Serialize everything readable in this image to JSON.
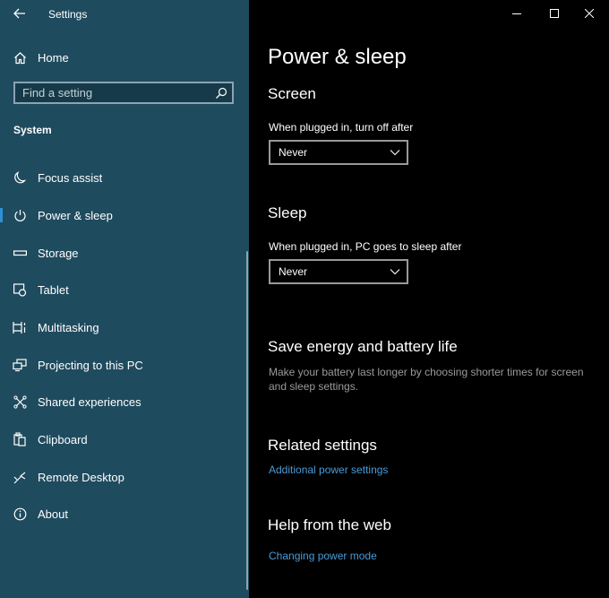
{
  "window": {
    "title": "Settings",
    "controls": {
      "minimize": "minimize",
      "maximize": "maximize",
      "close": "close"
    }
  },
  "sidebar": {
    "home_label": "Home",
    "search": {
      "placeholder": "Find a setting",
      "value": ""
    },
    "section_label": "System",
    "items": [
      {
        "label": "Focus assist",
        "icon": "moon-icon",
        "active": false
      },
      {
        "label": "Power & sleep",
        "icon": "power-icon",
        "active": true
      },
      {
        "label": "Storage",
        "icon": "storage-icon",
        "active": false
      },
      {
        "label": "Tablet",
        "icon": "tablet-icon",
        "active": false
      },
      {
        "label": "Multitasking",
        "icon": "multitasking-icon",
        "active": false
      },
      {
        "label": "Projecting to this PC",
        "icon": "projecting-icon",
        "active": false
      },
      {
        "label": "Shared experiences",
        "icon": "shared-icon",
        "active": false
      },
      {
        "label": "Clipboard",
        "icon": "clipboard-icon",
        "active": false
      },
      {
        "label": "Remote Desktop",
        "icon": "remote-desktop-icon",
        "active": false
      },
      {
        "label": "About",
        "icon": "info-icon",
        "active": false
      }
    ]
  },
  "main": {
    "page_title": "Power & sleep",
    "screen": {
      "heading": "Screen",
      "label": "When plugged in, turn off after",
      "value": "Never"
    },
    "sleep": {
      "heading": "Sleep",
      "label": "When plugged in, PC goes to sleep after",
      "value": "Never"
    },
    "save_energy": {
      "heading": "Save energy and battery life",
      "description": "Make your battery last longer by choosing shorter times for screen and sleep settings."
    },
    "related": {
      "heading": "Related settings",
      "link": "Additional power settings"
    },
    "help": {
      "heading": "Help from the web",
      "link": "Changing power mode"
    }
  },
  "colors": {
    "sidebar_bg": "#1f4b5e",
    "main_bg": "#000000",
    "accent": "#2d8fd8",
    "link": "#4a9bd8"
  }
}
